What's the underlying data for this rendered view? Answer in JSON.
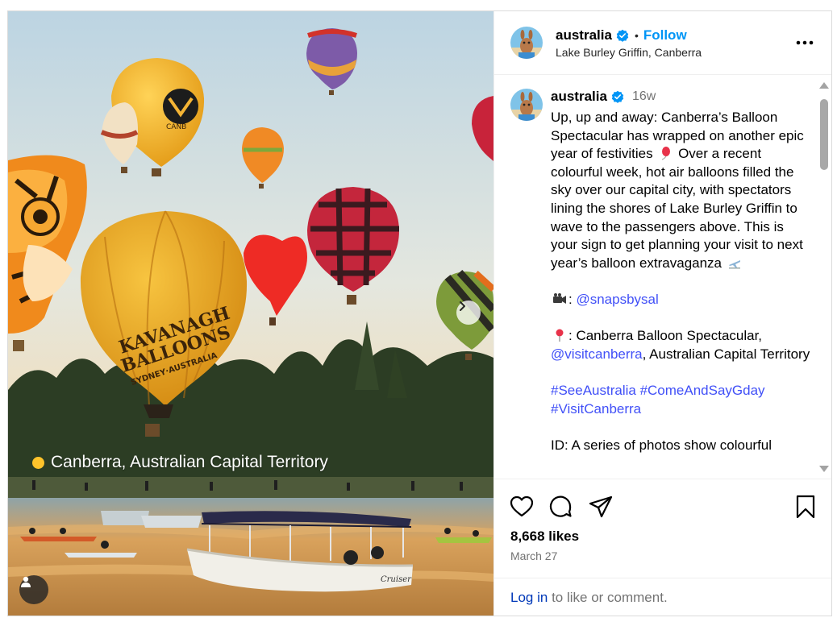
{
  "post": {
    "username": "australia",
    "follow_label": "Follow",
    "dot_separator": "•",
    "location": "Lake Burley Griffin, Canberra",
    "time_ago": "16w",
    "caption": {
      "p1_a": "Up, up and away: Canberra’s Balloon Spectacular has wrapped on another epic year of festivities",
      "p1_b": "Over a recent colourful week, hot air balloons filled the sky over our capital city, with spectators lining the shores of Lake Burley Griffin to wave to the passengers above. This is your sign to get planning your visit to next year’s balloon extravaganza",
      "credit_sep": ":",
      "credit_handle": "@snapsbysal",
      "loc_prefix": ": Canberra Balloon Spectacular,",
      "loc_handle": "@visitcanberra",
      "loc_suffix": ", Australian Capital Territory",
      "hashtags": [
        "#SeeAustralia",
        "#ComeAndSayGday",
        "#VisitCanberra"
      ],
      "id_line": "ID: A series of photos show colourful"
    },
    "likes": "8,668 likes",
    "date": "March 27",
    "login_link": "Log in",
    "login_suffix": "to like or comment."
  },
  "media": {
    "overlay_location": "Canberra, Australian Capital Territory",
    "balloon_text_1": "KAVANAGH",
    "balloon_text_2": "BALLOONS",
    "balloon_text_3": "SYDNEY·AUSTRALIA",
    "balloon_text_small": "CANB",
    "boat_name": "Cruiser"
  },
  "colors": {
    "accent_blue": "#0095f6",
    "link_blue": "#4150f7",
    "verified": "#0095f6",
    "overlay_dot": "#ffc42b"
  },
  "icons": [
    "verified-icon",
    "more-options-icon",
    "next-arrow-icon",
    "tag-user-icon",
    "heart-icon",
    "comment-icon",
    "share-icon",
    "bookmark-icon",
    "balloon-emoji",
    "airplane-emoji",
    "camera-emoji",
    "pin-emoji"
  ]
}
